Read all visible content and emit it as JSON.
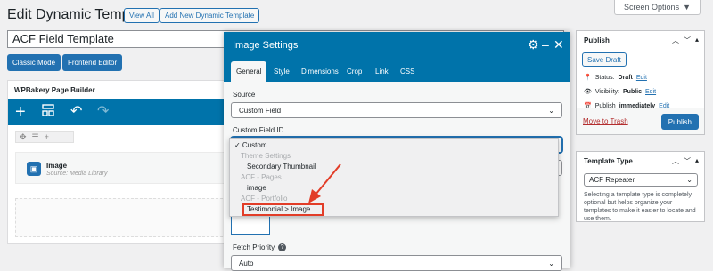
{
  "screen_options": {
    "label": "Screen Options",
    "arrow": "▼"
  },
  "header": {
    "title": "Edit Dynamic Template",
    "view_all": "View All",
    "add_new": "Add New Dynamic Template"
  },
  "post_title": "ACF Field Template",
  "buttons": {
    "classic_mode": "Classic Mode",
    "frontend_editor": "Frontend Editor"
  },
  "wpbakery": {
    "title": "WPBakery Page Builder",
    "toolbar_icons": [
      "plus-icon",
      "layout-icon",
      "undo-icon",
      "redo-icon"
    ],
    "element_name": "Image",
    "element_source": "Source: Media Library"
  },
  "modal": {
    "title": "Image Settings",
    "tabs": [
      "General",
      "Style",
      "Dimensions",
      "Crop",
      "Link",
      "CSS"
    ],
    "active_tab": "General",
    "source_label": "Source",
    "source_value": "Custom Field",
    "field_id_label": "Custom Field ID",
    "fetch_priority_label": "Fetch Priority",
    "fetch_priority_value": "Auto"
  },
  "dropdown": {
    "items": [
      {
        "text": "✓ Custom",
        "type": "option"
      },
      {
        "text": "Theme Settings",
        "type": "group"
      },
      {
        "text": "Secondary Thumbnail",
        "type": "option"
      },
      {
        "text": "ACF - Pages",
        "type": "group"
      },
      {
        "text": "image",
        "type": "option"
      },
      {
        "text": "ACF - Portfolio",
        "type": "group"
      },
      {
        "text": "Testimonial > Image",
        "type": "option",
        "highlighted": true
      }
    ],
    "highlight_color": "#e23d28"
  },
  "publish": {
    "title": "Publish",
    "save_draft": "Save Draft",
    "status_label": "Status:",
    "status_value": "Draft",
    "visibility_label": "Visibility:",
    "visibility_value": "Public",
    "publish_label": "Publish",
    "publish_when": "immediately",
    "edit": "Edit",
    "move_to_trash": "Move to Trash",
    "publish_button": "Publish"
  },
  "template_type": {
    "title": "Template Type",
    "value": "ACF Repeater",
    "description": "Selecting a template type is completely optional but helps organize your templates to make it easier to locate and use them."
  },
  "colors": {
    "accent": "#2271b1",
    "toolbar": "#0073aa",
    "danger": "#b32d2e"
  }
}
